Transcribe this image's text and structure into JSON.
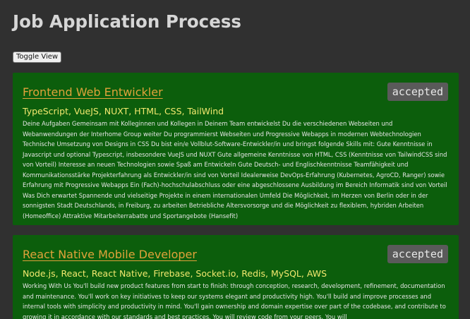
{
  "page": {
    "title": "Job Application Process",
    "toggle_label": "Toggle View"
  },
  "jobs": [
    {
      "title": "Frontend Web Entwickler",
      "status": "accepted",
      "skills": "TypeScript, VueJS, NUXT, HTML, CSS, TailWind",
      "description": "Deine Aufgaben Gemeinsam mit Kolleginnen und Kollegen in Deinem Team entwickelst Du die verschiedenen Webseiten und Webanwendungen der Interhome Group weiter Du programmierst Webseiten und Progressive Webapps in modernen Webtechnologien Technische Umsetzung von Designs in CSS Du bist ein/e Vollblut-Software-Entwickler/in und bringst folgende Skills mit: Gute Kenntnisse in Javascript und optional Typescript, insbesondere VueJS und NUXT Gute allgemeine Kenntnisse von HTML, CSS (Kenntnisse von TailwindCSS sind von Vorteil) Interesse an neuen Technologien sowie Spaß am Entwickeln Gute Deutsch- und Englischkenntnisse Teamfähigkeit und Kommunikationsstärke Projekterfahrung als Entwickler/in sind von Vorteil Idealerweise DevOps-Erfahrung (Kubernetes, AgroCD, Ranger) sowie Erfahrung mit Progressive Webapps Ein (Fach)-hochschulabschluss oder eine abgeschlossene Ausbildung im Bereich Informatik sind von Vorteil Was Dich erwartet Spannende und vielseitige Projekte in einem internationalen Umfeld Die Möglichkeit, im Herzen von Berlin oder in der sonnigsten Stadt Deutschlands, in Freiburg, zu arbeiten Betriebliche Altersvorsorge und die Möglichkeit zu flexiblem, hybriden Arbeiten (Homeoffice) Attraktive Mitarbeiterrabatte und Sportangebote (Hansefit)"
    },
    {
      "title": "React Native Mobile Developer",
      "status": "accepted",
      "skills": "Node.js, React, React Native, Firebase, Socket.io, Redis, MySQL, AWS",
      "description": "Working With Us You'll build new product features from start to finish: through conception, research, development, refinement, documentation and maintenance. You'll work on key initiatives to keep our systems elegant and productivity high. You'll build and improve processes and internal tools with simplicity and productivity in mind. You'll gain ownership and domain expertise over part of the codebase, and contribute to growing it in accordance with our standards and best practices. You will review code from your peers. You will"
    }
  ],
  "colors": {
    "background": "#303030",
    "card": "#0c5e0c",
    "title_link": "#e0a23a",
    "skills": "#f2e86e",
    "badge": "#5a5a5a"
  }
}
